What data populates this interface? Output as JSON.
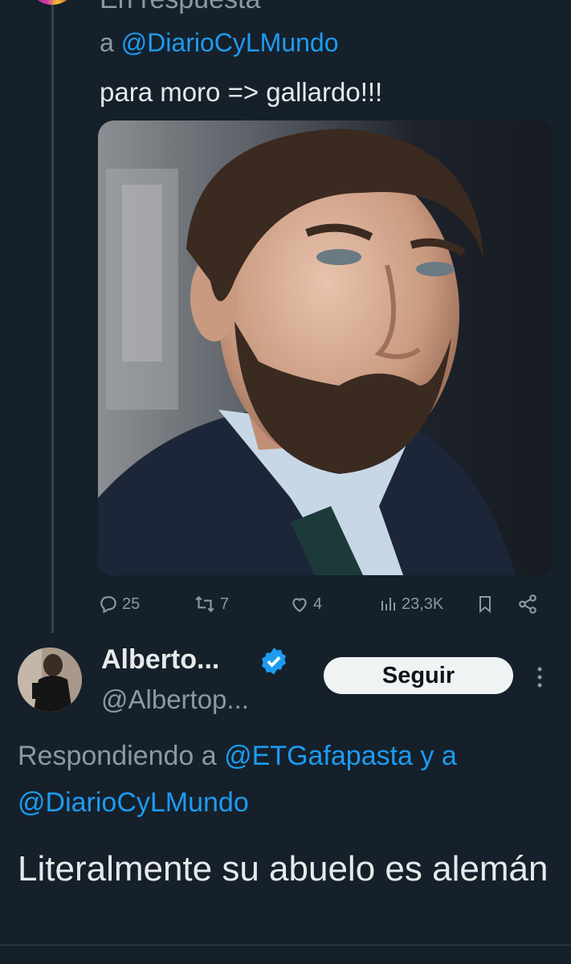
{
  "tweet1": {
    "clipped_text": "En respuesta",
    "reply_prefix": "a",
    "reply_mention": "@DiarioCyLMundo",
    "text": "para moro => gallardo!!!",
    "stats": {
      "replies": "25",
      "retweets": "7",
      "likes": "4",
      "views": "23,3K"
    }
  },
  "tweet2": {
    "name": "Alberto...",
    "handle": "@Albertop...",
    "follow_label": "Seguir",
    "responding_prefix": "Respondiendo a",
    "responding_mention1": "@ETGafapasta",
    "responding_and": "y a",
    "responding_mention2": "@DiarioCyLMundo",
    "text": "Literalmente su abuelo es alemán"
  },
  "colors": {
    "background": "#15202b",
    "accent": "#1d9bf0",
    "secondary_text": "#8b98a5",
    "primary_text": "#e7e9ea"
  },
  "icons": [
    "reply-icon",
    "retweet-icon",
    "like-icon",
    "views-icon",
    "bookmark-icon",
    "share-icon",
    "verified-icon",
    "more-icon"
  ]
}
